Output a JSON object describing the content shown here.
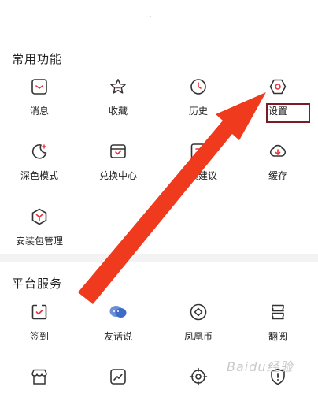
{
  "sections": [
    {
      "title": "常用功能",
      "items": [
        {
          "label": "消息",
          "icon": "message-icon"
        },
        {
          "label": "收藏",
          "icon": "star-icon"
        },
        {
          "label": "历史",
          "icon": "clock-icon"
        },
        {
          "label": "设置",
          "icon": "settings-hexagon-icon"
        },
        {
          "label": "深色模式",
          "icon": "moon-icon"
        },
        {
          "label": "兑换中心",
          "icon": "exchange-box-icon"
        },
        {
          "label": "反馈建议",
          "icon": "feedback-icon"
        },
        {
          "label": "缓存",
          "icon": "cloud-download-icon"
        },
        {
          "label": "安装包管理",
          "icon": "package-icon"
        }
      ]
    },
    {
      "title": "平台服务",
      "items": [
        {
          "label": "签到",
          "icon": "checkin-icon"
        },
        {
          "label": "友话说",
          "icon": "chat-bubbles-icon"
        },
        {
          "label": "凤凰币",
          "icon": "coin-icon"
        },
        {
          "label": "翻阅",
          "icon": "book-icon"
        },
        {
          "label": "",
          "icon": "store-icon"
        },
        {
          "label": "",
          "icon": "trend-chart-icon"
        },
        {
          "label": "",
          "icon": "target-icon"
        },
        {
          "label": "",
          "icon": "shield-alert-icon"
        }
      ]
    }
  ],
  "colors": {
    "accent": "#e8313a",
    "icon_stroke": "#333333",
    "arrow": "#f03a1e",
    "highlight_box": "#7a1c24"
  },
  "watermark": "Baidu经验"
}
